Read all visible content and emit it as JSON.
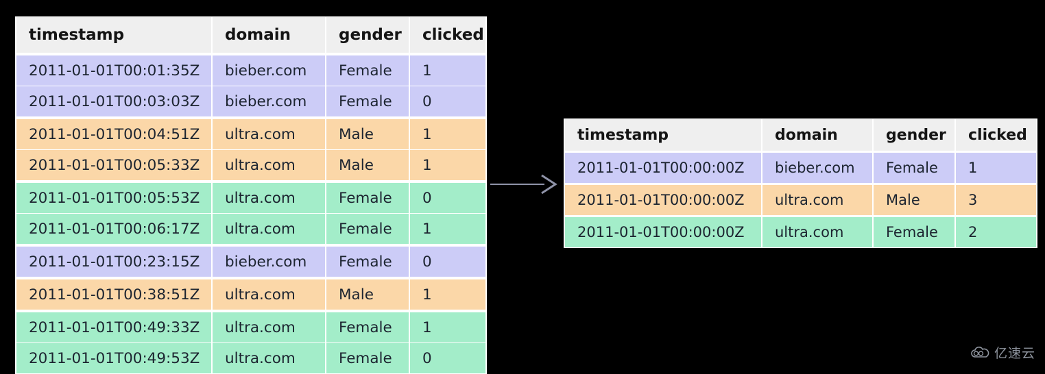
{
  "background_color": "#000000",
  "colors": {
    "group_bieber_female": "#ccccf7",
    "group_ultra_male": "#fbd7a8",
    "group_ultra_female": "#a3edc9",
    "header_bg": "#efefef",
    "table_bg": "#ffffff",
    "text": "#1c2430",
    "arrow": "#8f93a8",
    "watermark": "#9aa0ab"
  },
  "input_table": {
    "columns": [
      "timestamp",
      "domain",
      "gender",
      "clicked"
    ],
    "rows": [
      {
        "timestamp": "2011-01-01T00:01:35Z",
        "domain": "bieber.com",
        "gender": "Female",
        "clicked": "1",
        "group": "g-lav",
        "group_start": true
      },
      {
        "timestamp": "2011-01-01T00:03:03Z",
        "domain": "bieber.com",
        "gender": "Female",
        "clicked": "0",
        "group": "g-lav",
        "group_start": false
      },
      {
        "timestamp": "2011-01-01T00:04:51Z",
        "domain": "ultra.com",
        "gender": "Male",
        "clicked": "1",
        "group": "g-org",
        "group_start": true
      },
      {
        "timestamp": "2011-01-01T00:05:33Z",
        "domain": "ultra.com",
        "gender": "Male",
        "clicked": "1",
        "group": "g-org",
        "group_start": false
      },
      {
        "timestamp": "2011-01-01T00:05:53Z",
        "domain": "ultra.com",
        "gender": "Female",
        "clicked": "0",
        "group": "g-grn",
        "group_start": true
      },
      {
        "timestamp": "2011-01-01T00:06:17Z",
        "domain": "ultra.com",
        "gender": "Female",
        "clicked": "1",
        "group": "g-grn",
        "group_start": false
      },
      {
        "timestamp": "2011-01-01T00:23:15Z",
        "domain": "bieber.com",
        "gender": "Female",
        "clicked": "0",
        "group": "g-lav",
        "group_start": true
      },
      {
        "timestamp": "2011-01-01T00:38:51Z",
        "domain": "ultra.com",
        "gender": "Male",
        "clicked": "1",
        "group": "g-org",
        "group_start": true
      },
      {
        "timestamp": "2011-01-01T00:49:33Z",
        "domain": "ultra.com",
        "gender": "Female",
        "clicked": "1",
        "group": "g-grn",
        "group_start": true
      },
      {
        "timestamp": "2011-01-01T00:49:53Z",
        "domain": "ultra.com",
        "gender": "Female",
        "clicked": "0",
        "group": "g-grn",
        "group_start": false
      }
    ]
  },
  "output_table": {
    "columns": [
      "timestamp",
      "domain",
      "gender",
      "clicked"
    ],
    "rows": [
      {
        "timestamp": "2011-01-01T00:00:00Z",
        "domain": "bieber.com",
        "gender": "Female",
        "clicked": "1",
        "group": "g-lav"
      },
      {
        "timestamp": "2011-01-01T00:00:00Z",
        "domain": "ultra.com",
        "gender": "Male",
        "clicked": "3",
        "group": "g-org"
      },
      {
        "timestamp": "2011-01-01T00:00:00Z",
        "domain": "ultra.com",
        "gender": "Female",
        "clicked": "2",
        "group": "g-grn"
      }
    ]
  },
  "arrow": {
    "icon": "arrow-right-icon",
    "direction": "right"
  },
  "watermark": {
    "icon": "cloud-icon",
    "text": "亿速云"
  }
}
